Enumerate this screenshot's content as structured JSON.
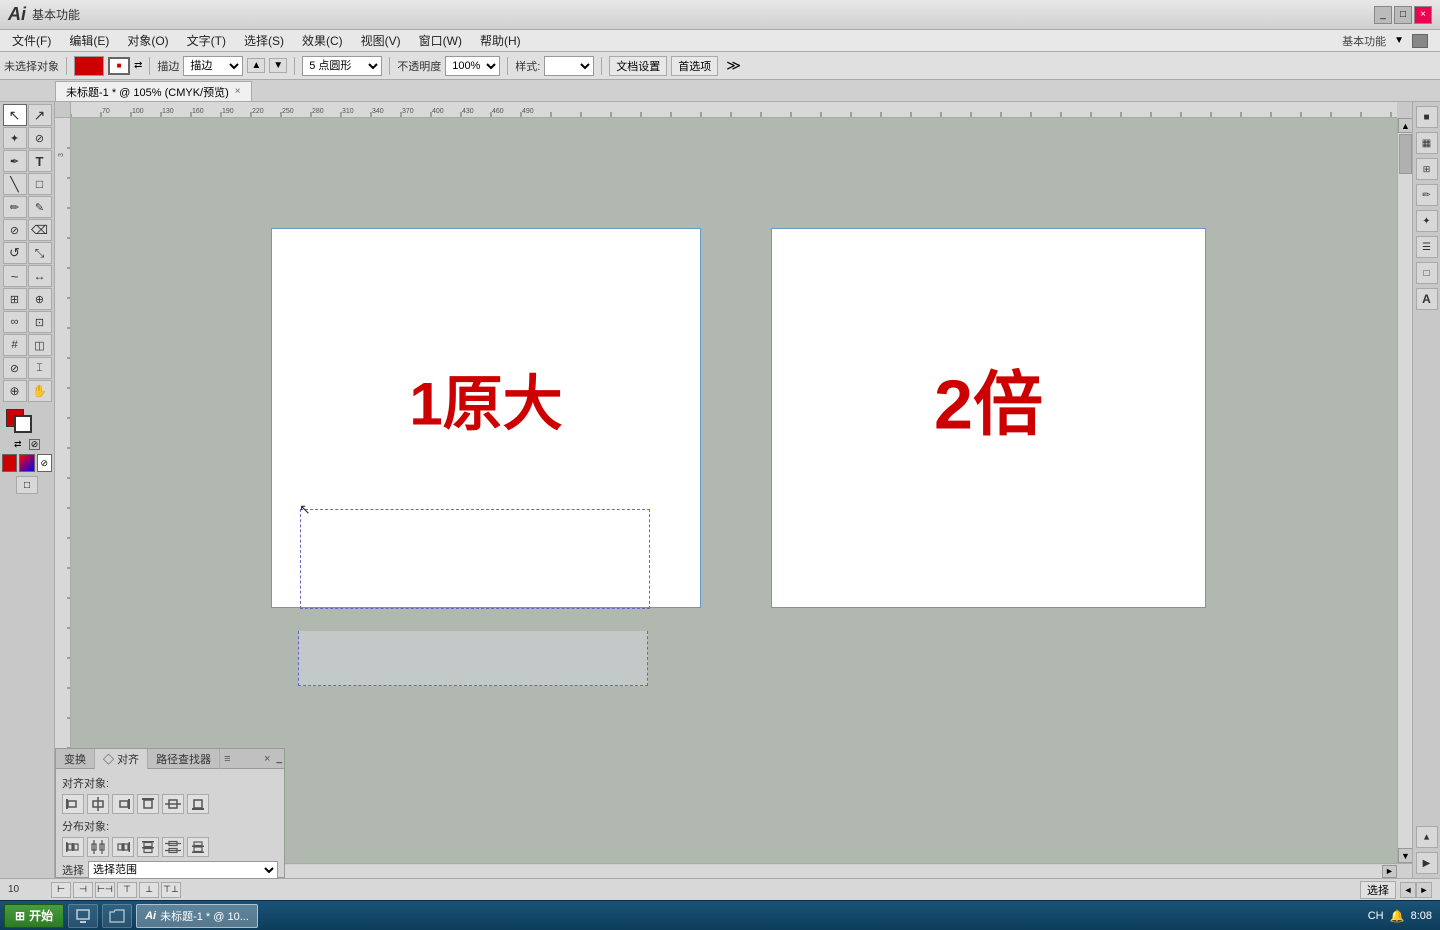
{
  "app": {
    "logo": "Ai",
    "title": "基本功能",
    "window_controls": [
      "minimize",
      "maximize",
      "close"
    ]
  },
  "menubar": {
    "items": [
      "文件(F)",
      "编辑(E)",
      "对象(O)",
      "文字(T)",
      "选择(S)",
      "效果(C)",
      "视图(V)",
      "窗口(W)",
      "帮助(H)"
    ],
    "workspace": "基本功能",
    "workspace_arrow": "▼"
  },
  "toolbar": {
    "label_unselected": "未选择对象",
    "stroke_label": "描边",
    "point_shape": "5 点圆形",
    "opacity_label": "不透明度",
    "opacity_value": "100%",
    "style_label": "样式:",
    "doc_settings": "文档设置",
    "preferences": "首选项"
  },
  "tabbar": {
    "active_tab": "未标题-1 * @ 105% (CMYK/预览)",
    "close_label": "×"
  },
  "canvas": {
    "artboard1_text": "1原大",
    "artboard2_text": "2倍",
    "ruler_unit": "px"
  },
  "bottom_panel": {
    "tabs": [
      "变换",
      "对齐",
      "路径查找器"
    ],
    "align_label": "对齐对象:",
    "distribute_label": "分布对象:",
    "select_label": "选择",
    "align_buttons": [
      "align-left",
      "align-center-h",
      "align-right",
      "align-top",
      "align-center-v",
      "align-bottom"
    ],
    "distribute_buttons": [
      "dist-left",
      "dist-center-h",
      "dist-right",
      "dist-top",
      "dist-center-v",
      "dist-bottom"
    ],
    "align_icons": [
      "⊢",
      "⊣",
      "⊢⊣",
      "⊤",
      "⊥",
      "⊤⊥"
    ],
    "distribute_icons": [
      "⊢",
      "⊢⊣",
      "⊣",
      "⊤",
      "⊤⊥",
      "⊥"
    ]
  },
  "statusbar": {
    "select_label": "选择",
    "nav_arrows": [
      "◄",
      "►"
    ]
  },
  "taskbar": {
    "start_label": "开始",
    "items": [
      {
        "label": "未标题-1 * @ 10...",
        "active": true
      }
    ],
    "time": "8:08",
    "lang": "CH"
  },
  "tools": {
    "buttons": [
      {
        "id": "select",
        "icon": "↖",
        "active": true
      },
      {
        "id": "direct-select",
        "icon": "↗"
      },
      {
        "id": "magic-wand",
        "icon": "✦"
      },
      {
        "id": "lasso",
        "icon": "⊘"
      },
      {
        "id": "pen",
        "icon": "✒"
      },
      {
        "id": "type",
        "icon": "T"
      },
      {
        "id": "line",
        "icon": "/"
      },
      {
        "id": "rect",
        "icon": "□"
      },
      {
        "id": "brush",
        "icon": "✏"
      },
      {
        "id": "pencil",
        "icon": "✎"
      },
      {
        "id": "blob-brush",
        "icon": "✏"
      },
      {
        "id": "eraser",
        "icon": "⌫"
      },
      {
        "id": "rotate",
        "icon": "↺"
      },
      {
        "id": "scale",
        "icon": "⤡"
      },
      {
        "id": "warp",
        "icon": "~"
      },
      {
        "id": "width",
        "icon": "↔"
      },
      {
        "id": "free-transform",
        "icon": "⊞"
      },
      {
        "id": "shape-builder",
        "icon": "⊕"
      },
      {
        "id": "blend",
        "icon": "∞"
      },
      {
        "id": "eyedropper",
        "icon": "⊘"
      },
      {
        "id": "measure",
        "icon": "⌶"
      },
      {
        "id": "zoom",
        "icon": "⊕"
      },
      {
        "id": "hand",
        "icon": "✋"
      },
      {
        "id": "fill-stroke",
        "icon": "■"
      },
      {
        "id": "screen-mode",
        "icon": "□"
      }
    ]
  },
  "right_panel": {
    "buttons": [
      {
        "id": "color",
        "icon": "■"
      },
      {
        "id": "gradient",
        "icon": "▦"
      },
      {
        "id": "swatches",
        "icon": "⊞"
      },
      {
        "id": "brushes",
        "icon": "✏"
      },
      {
        "id": "symbols",
        "icon": "✦"
      },
      {
        "id": "layers",
        "icon": "☰"
      },
      {
        "id": "artboards",
        "icon": "□"
      },
      {
        "id": "type",
        "icon": "A"
      },
      {
        "id": "align",
        "icon": "≡"
      },
      {
        "id": "go",
        "icon": "▶"
      }
    ]
  }
}
